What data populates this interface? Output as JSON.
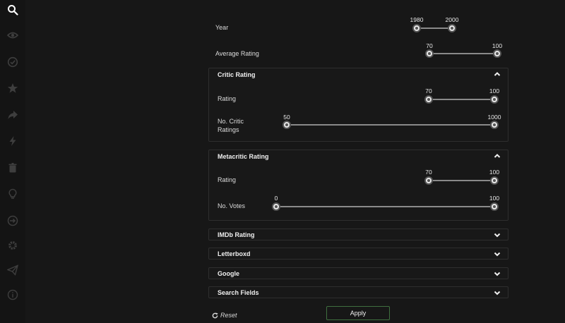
{
  "sidebar": {
    "icons": [
      "search-icon",
      "eye-icon",
      "check-circle-icon",
      "star-icon",
      "share-icon",
      "bolt-icon",
      "trash-icon",
      "lightbulb-icon",
      "sign-in-icon",
      "gear-icon",
      "paper-plane-icon",
      "info-icon"
    ]
  },
  "filters": {
    "year": {
      "label": "Year",
      "min": "1980",
      "max": "2000"
    },
    "average_rating": {
      "label": "Average Rating",
      "min": "70",
      "max": "100"
    }
  },
  "panels": {
    "critic": {
      "title": "Critic Rating",
      "rating": {
        "label": "Rating",
        "min": "70",
        "max": "100"
      },
      "no_critic": {
        "label_line1": "No. Critic",
        "label_line2": "Ratings",
        "min": "50",
        "max": "1000"
      }
    },
    "metacritic": {
      "title": "Metacritic Rating",
      "rating": {
        "label": "Rating",
        "min": "70",
        "max": "100"
      },
      "votes": {
        "label": "No. Votes",
        "min": "0",
        "max": "100"
      }
    },
    "imdb": {
      "title": "IMDb Rating"
    },
    "letterboxd": {
      "title": "Letterboxd"
    },
    "google": {
      "title": "Google"
    },
    "search_fields": {
      "title": "Search Fields"
    }
  },
  "actions": {
    "apply": "Apply",
    "reset": "Reset"
  },
  "colors": {
    "background": "#171717",
    "apply_border": "#3f6f3f"
  }
}
